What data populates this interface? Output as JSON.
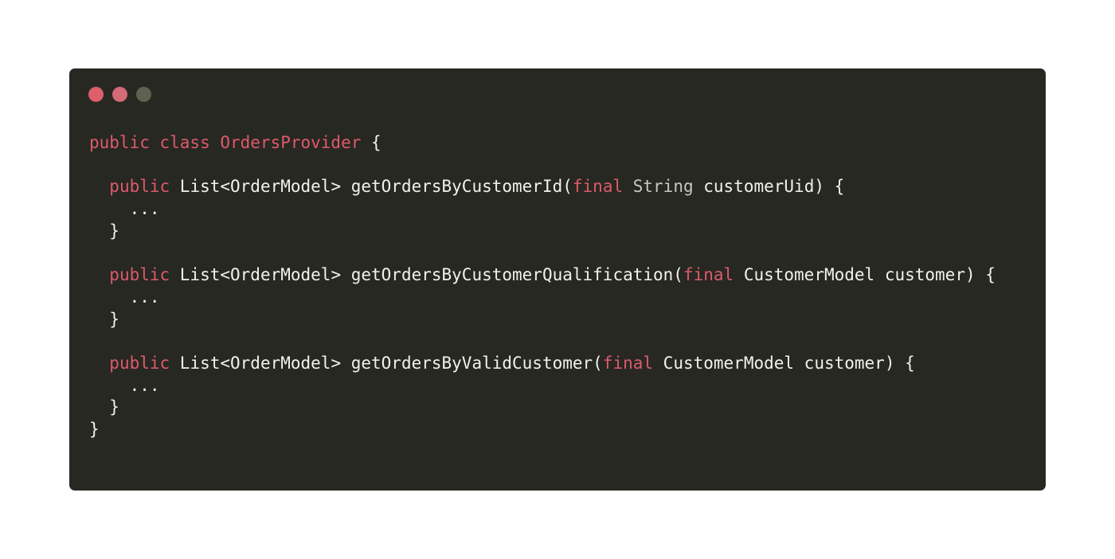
{
  "window": {
    "dots": [
      {
        "name": "close",
        "color": "#dc5f6a"
      },
      {
        "name": "minimize",
        "color": "#d36a76"
      },
      {
        "name": "maximize",
        "color": "#5f6250"
      }
    ]
  },
  "code": {
    "lines": [
      {
        "indent": "",
        "tokens": [
          {
            "kind": "kw",
            "text": "public class OrdersProvider"
          },
          {
            "kind": "txt",
            "text": " {"
          }
        ]
      },
      {
        "indent": "",
        "tokens": []
      },
      {
        "indent": "  ",
        "tokens": [
          {
            "kind": "kw",
            "text": "public"
          },
          {
            "kind": "txt",
            "text": " List<OrderModel> getOrdersByCustomerId("
          },
          {
            "kind": "kw",
            "text": "final"
          },
          {
            "kind": "typ",
            "text": " String"
          },
          {
            "kind": "txt",
            "text": " customerUid) {"
          }
        ]
      },
      {
        "indent": "    ",
        "tokens": [
          {
            "kind": "txt",
            "text": "..."
          }
        ]
      },
      {
        "indent": "  ",
        "tokens": [
          {
            "kind": "txt",
            "text": "}"
          }
        ]
      },
      {
        "indent": "",
        "tokens": []
      },
      {
        "indent": "  ",
        "tokens": [
          {
            "kind": "kw",
            "text": "public"
          },
          {
            "kind": "txt",
            "text": " List<OrderModel> getOrdersByCustomerQualification("
          },
          {
            "kind": "kw",
            "text": "final"
          },
          {
            "kind": "txt",
            "text": " CustomerModel customer) {"
          }
        ]
      },
      {
        "indent": "    ",
        "tokens": [
          {
            "kind": "txt",
            "text": "..."
          }
        ]
      },
      {
        "indent": "  ",
        "tokens": [
          {
            "kind": "txt",
            "text": "}"
          }
        ]
      },
      {
        "indent": "",
        "tokens": []
      },
      {
        "indent": "  ",
        "tokens": [
          {
            "kind": "kw",
            "text": "public"
          },
          {
            "kind": "txt",
            "text": " List<OrderModel> getOrdersByValidCustomer("
          },
          {
            "kind": "kw",
            "text": "final"
          },
          {
            "kind": "txt",
            "text": " CustomerModel customer) {"
          }
        ]
      },
      {
        "indent": "    ",
        "tokens": [
          {
            "kind": "txt",
            "text": "..."
          }
        ]
      },
      {
        "indent": "  ",
        "tokens": [
          {
            "kind": "txt",
            "text": "}"
          }
        ]
      },
      {
        "indent": "",
        "tokens": [
          {
            "kind": "txt",
            "text": "}"
          }
        ]
      }
    ]
  },
  "colors": {
    "background": "#ffffff",
    "editor_background": "#272822",
    "keyword": "#dd5a6a",
    "type": "#c8c8be",
    "text": "#f2f2ec"
  }
}
